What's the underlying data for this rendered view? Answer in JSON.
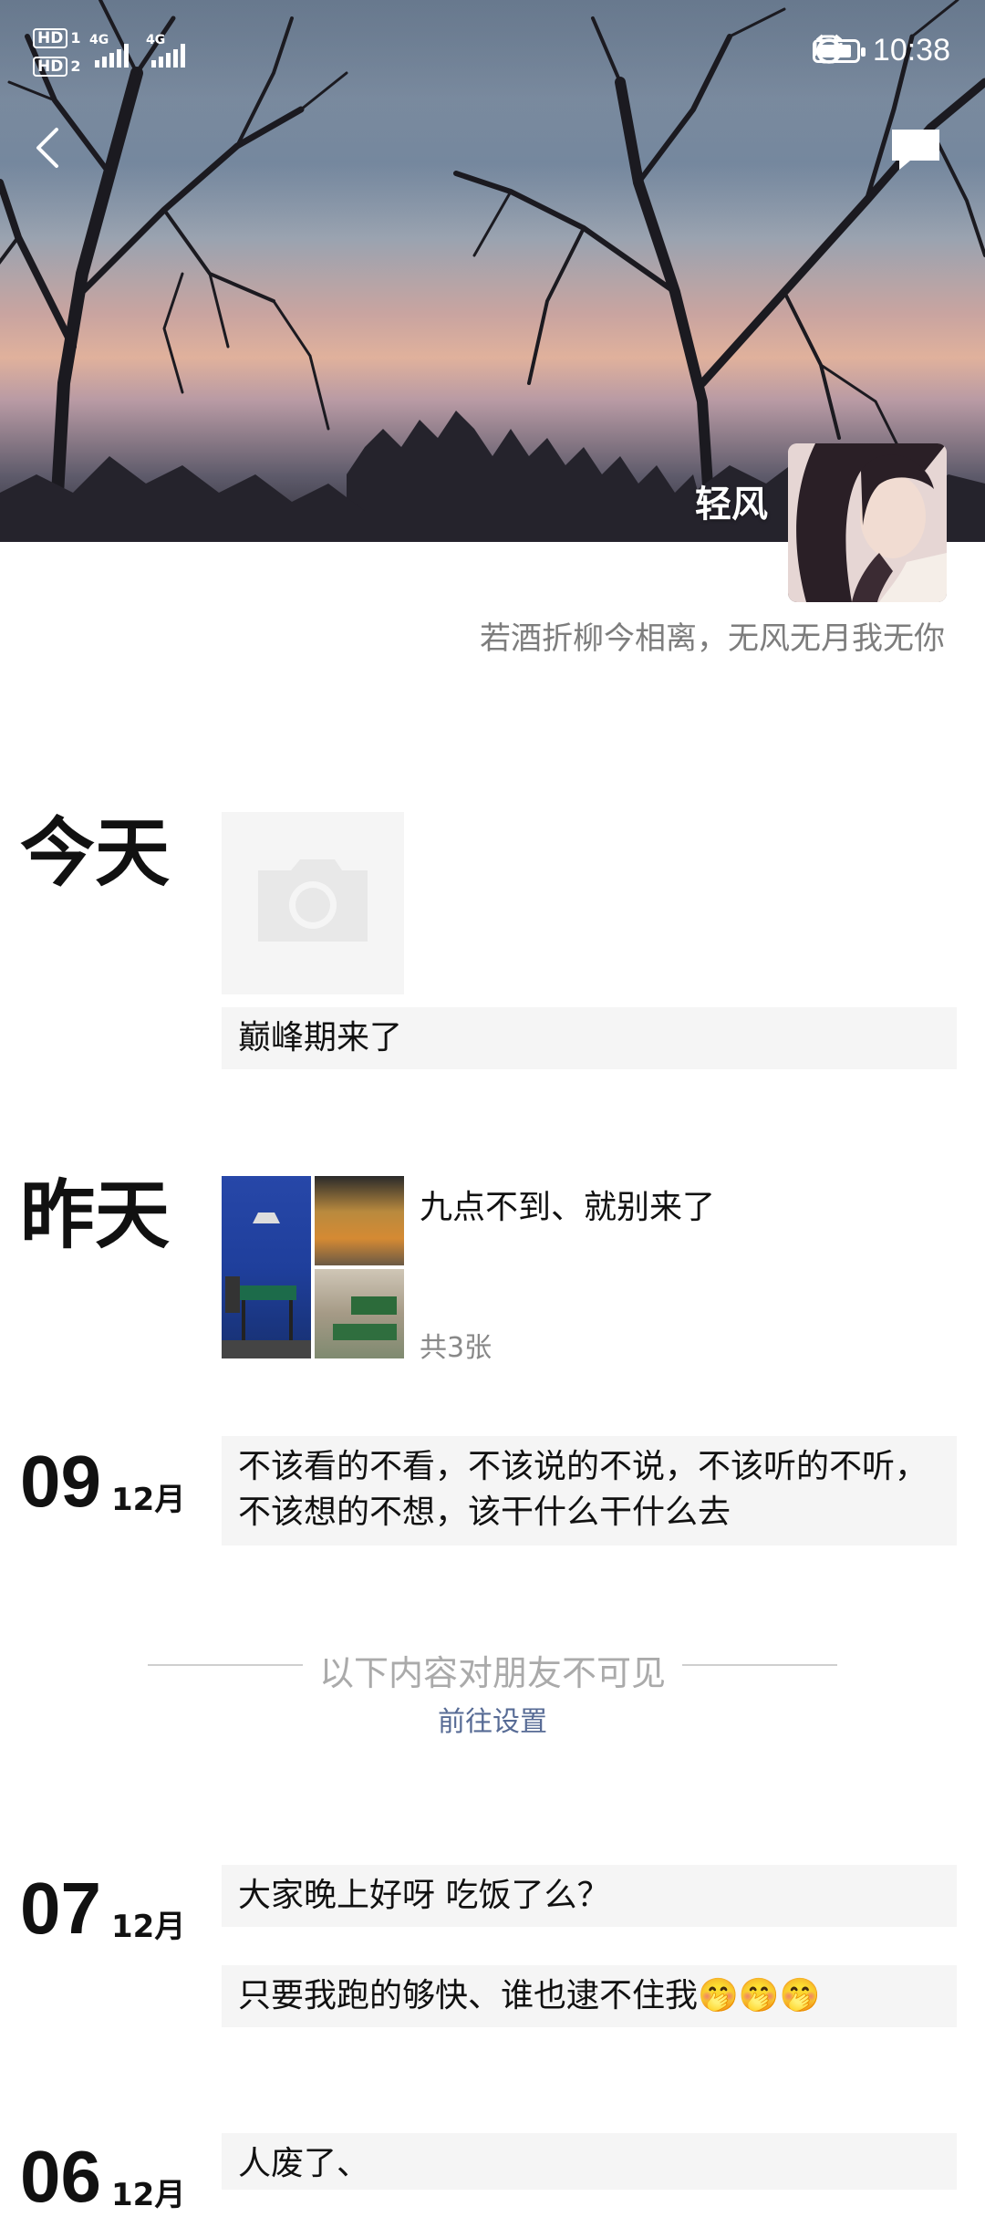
{
  "status": {
    "hd1": "HD",
    "hd1_num": "1",
    "hd2": "HD",
    "hd2_num": "2",
    "net1": "4G",
    "net2": "4G",
    "time": "10:38",
    "battery_level": 0.9
  },
  "profile": {
    "name": "轻风",
    "signature": "若酒折柳今相离，无风无月我无你"
  },
  "timeline": {
    "today": {
      "label": "今天",
      "text": "巅峰期来了"
    },
    "yesterday": {
      "label": "昨天",
      "text": "九点不到、就别来了",
      "count": "共3张"
    },
    "entry_0912": {
      "day": "09",
      "month": "12月",
      "text_line1": "不该看的不看，不该说的不说，不该听的不听，",
      "text_line2": "不该想的不想，该干什么干什么去"
    },
    "hidden_notice": {
      "label": "以下内容对朋友不可见",
      "link": "前往设置"
    },
    "entry_0712": {
      "day": "07",
      "month": "12月",
      "text1": "大家晚上好呀  吃饭了么？",
      "text2": "只要我跑的够快、谁也逮不住我🤭🤭🤭"
    },
    "entry_0612": {
      "day": "06",
      "month": "12月",
      "text": "人废了、"
    }
  }
}
